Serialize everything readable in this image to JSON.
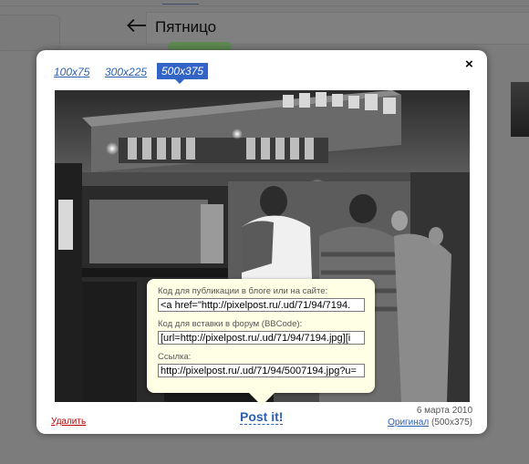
{
  "background": {
    "title": "Пятницо"
  },
  "modal": {
    "size_tabs": [
      "100x75",
      "300x225",
      "500x375"
    ],
    "active_tab": "500x375",
    "close_label": "×",
    "embed": {
      "blog_label": "Код для публикации в блоге или на сайте:",
      "blog_value": "<a href=\"http://pixelpost.ru/.ud/71/94/7194.",
      "forum_label": "Код для вставки в форум (BBCode):",
      "forum_value": "[url=http://pixelpost.ru/.ud/71/94/7194.jpg][i",
      "link_label": "Ссылка:",
      "link_value": "http://pixelpost.ru/.ud/71/94/5007194.jpg?u="
    },
    "postit_label": "Post it!",
    "delete_label": "Удалить",
    "date": "6 марта 2010",
    "original_label": "Оригинал",
    "original_size": "(500x375)"
  },
  "colors": {
    "accent": "#3264c8",
    "link": "#2b5fb0",
    "delete": "#c00000",
    "popup_bg": "#ffffe6"
  }
}
